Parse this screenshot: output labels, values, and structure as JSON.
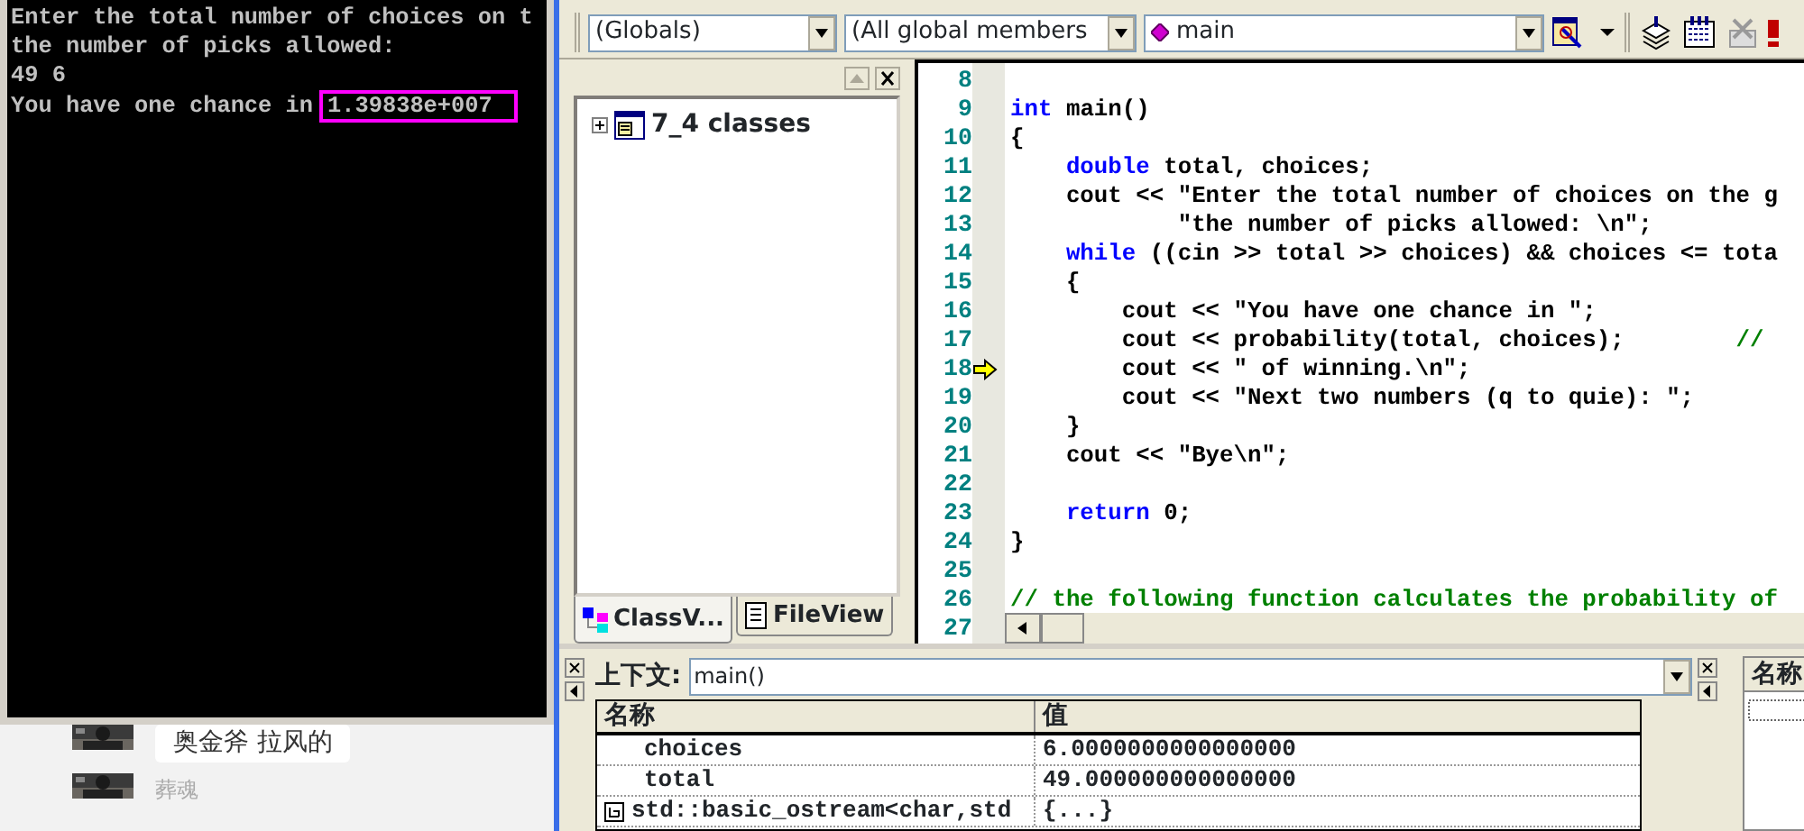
{
  "console": {
    "lines": [
      {
        "text": "Enter the total number of choices on t"
      },
      {
        "text": "the number of picks allowed:"
      },
      {
        "text": "49 6"
      },
      {
        "text": "You have one chance in",
        "result": "1.39838e+007"
      }
    ]
  },
  "chat": {
    "messages": [
      {
        "text": "奥金斧 拉风的",
        "kind": "bubble"
      },
      {
        "text": "葬魂",
        "kind": "name"
      }
    ]
  },
  "toolbar": {
    "combos": [
      {
        "value": "(Globals)",
        "kind": "plain"
      },
      {
        "value": "(All global members",
        "kind": "plain"
      },
      {
        "value": "main",
        "kind": "member"
      }
    ]
  },
  "class_view": {
    "tree": [
      {
        "label": "7_4 classes",
        "expanded": false
      }
    ],
    "tabs": [
      {
        "label": "ClassV...",
        "kind": "class",
        "selected": true
      },
      {
        "label": "FileView",
        "kind": "file",
        "selected": false
      }
    ]
  },
  "editor": {
    "lines": [
      {
        "number": "8",
        "execution_point": false
      },
      {
        "number": "9",
        "execution_point": false,
        "tokens": [
          {
            "text": "int",
            "kind": "keyword"
          },
          {
            "text": " main()",
            "kind": "plain"
          }
        ]
      },
      {
        "number": "10",
        "execution_point": false,
        "tokens": [
          {
            "text": "{",
            "kind": "plain"
          }
        ]
      },
      {
        "number": "11",
        "execution_point": false,
        "tokens": [
          {
            "text": "    double",
            "kind": "keyword"
          },
          {
            "text": " total, choices;",
            "kind": "plain"
          }
        ]
      },
      {
        "number": "12",
        "execution_point": false,
        "tokens": [
          {
            "text": "    cout << \"Enter the total number of choices on the g",
            "kind": "plain"
          }
        ]
      },
      {
        "number": "13",
        "execution_point": false,
        "tokens": [
          {
            "text": "            \"the number of picks allowed: \\n\";",
            "kind": "plain"
          }
        ]
      },
      {
        "number": "14",
        "execution_point": false,
        "tokens": [
          {
            "text": "    while",
            "kind": "keyword"
          },
          {
            "text": " ((cin >> total >> choices) && choices <= tota",
            "kind": "plain"
          }
        ]
      },
      {
        "number": "15",
        "execution_point": false,
        "tokens": [
          {
            "text": "    {",
            "kind": "plain"
          }
        ]
      },
      {
        "number": "16",
        "execution_point": false,
        "tokens": [
          {
            "text": "        cout << \"You have one chance in \";",
            "kind": "plain"
          }
        ]
      },
      {
        "number": "17",
        "execution_point": false,
        "tokens": [
          {
            "text": "        cout << probability(total, choices);        ",
            "kind": "plain"
          },
          {
            "text": "//",
            "kind": "comment"
          }
        ]
      },
      {
        "number": "18",
        "execution_point": true,
        "tokens": [
          {
            "text": "        cout << \" of winning.\\n\";",
            "kind": "plain"
          }
        ]
      },
      {
        "number": "19",
        "execution_point": false,
        "tokens": [
          {
            "text": "        cout << \"Next two numbers (q to quie): \";",
            "kind": "plain"
          }
        ]
      },
      {
        "number": "20",
        "execution_point": false,
        "tokens": [
          {
            "text": "    }",
            "kind": "plain"
          }
        ]
      },
      {
        "number": "21",
        "execution_point": false,
        "tokens": [
          {
            "text": "    cout << \"Bye\\n\";",
            "kind": "plain"
          }
        ]
      },
      {
        "number": "22",
        "execution_point": false
      },
      {
        "number": "23",
        "execution_point": false,
        "tokens": [
          {
            "text": "    return",
            "kind": "keyword"
          },
          {
            "text": " 0;",
            "kind": "plain"
          }
        ]
      },
      {
        "number": "24",
        "execution_point": false,
        "tokens": [
          {
            "text": "}",
            "kind": "plain"
          }
        ]
      },
      {
        "number": "25",
        "execution_point": false
      },
      {
        "number": "26",
        "execution_point": false,
        "tokens": [
          {
            "text": "// the following function calculates the probability of",
            "kind": "comment"
          }
        ]
      },
      {
        "number": "27",
        "execution_point": false
      }
    ]
  },
  "variables": {
    "context_label": "上下文:",
    "context_value": "main()",
    "columns": [
      "名称",
      "值"
    ],
    "rows": [
      {
        "name": "choices",
        "value": "6.0000000000000000",
        "expandable": false
      },
      {
        "name": "total",
        "value": "49.000000000000000",
        "expandable": false
      },
      {
        "name": "std::basic_ostream<char,std",
        "value": "{...}",
        "expandable": true
      }
    ]
  },
  "watch": {
    "columns": [
      "名称"
    ]
  }
}
